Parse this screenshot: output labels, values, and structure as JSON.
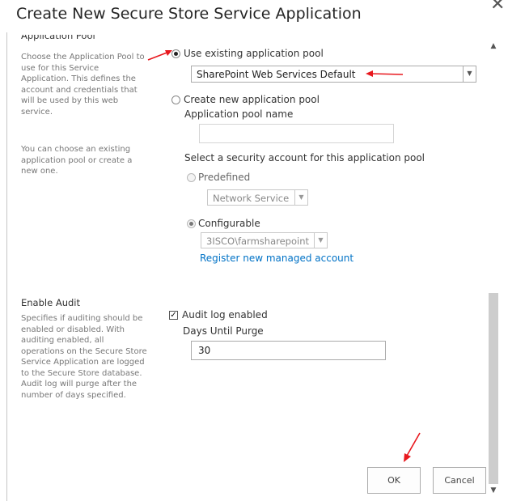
{
  "dialog": {
    "title": "Create New Secure Store Service Application",
    "close_glyph": "✕"
  },
  "app_pool": {
    "heading": "Application Pool",
    "desc1": "Choose the Application Pool to use for this Service Application.  This defines the account and credentials that will be used by this web service.",
    "desc2": "You can choose an existing application pool or create a new one.",
    "use_existing_label": "Use existing application pool",
    "existing_selected": "SharePoint Web Services Default",
    "create_new_label": "Create new application pool",
    "pool_name_label": "Application pool name",
    "pool_name_value": "",
    "security_label": "Select a security account for this application pool",
    "predefined_label": "Predefined",
    "predefined_selected": "Network Service",
    "configurable_label": "Configurable",
    "configurable_selected": "3ISCO\\farmsharepoint",
    "register_link": "Register new managed account"
  },
  "audit": {
    "heading": "Enable Audit",
    "desc": "Specifies if auditing should be enabled or disabled. With auditing enabled, all operations on the Secure Store Service Application are logged to the Secure Store database. Audit log will purge after the number of days specified.",
    "checkbox_label": "Audit log enabled",
    "checked": true,
    "days_label": "Days Until Purge",
    "days_value": "30"
  },
  "buttons": {
    "ok": "OK",
    "cancel": "Cancel"
  },
  "annotations": {
    "arrow_color": "#e8181e"
  }
}
